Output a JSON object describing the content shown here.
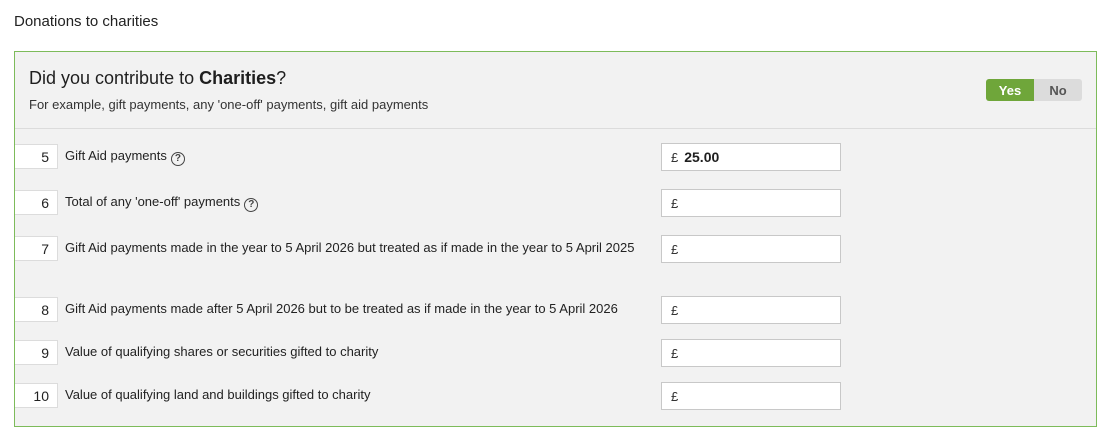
{
  "section_title": "Donations to charities",
  "question": {
    "prefix": "Did you contribute to ",
    "bold": "Charities",
    "suffix": "?",
    "hint": "For example, gift payments, any 'one-off' payments, gift aid payments"
  },
  "toggle": {
    "yes": "Yes",
    "no": "No",
    "selected": "Yes"
  },
  "rows": [
    {
      "num": "5",
      "label": "Gift Aid payments",
      "help": true,
      "currency": "£",
      "value": "25.00"
    },
    {
      "num": "6",
      "label": "Total of any 'one-off' payments",
      "help": true,
      "currency": "£",
      "value": ""
    },
    {
      "num": "7",
      "label": "Gift Aid payments made in the year to 5 April 2026 but treated as if made in the year to 5 April 2025",
      "help": false,
      "currency": "£",
      "value": ""
    },
    {
      "num": "8",
      "label": "Gift Aid payments made after 5 April 2026 but to be treated as if made in the year to 5 April 2026",
      "help": false,
      "currency": "£",
      "value": ""
    },
    {
      "num": "9",
      "label": "Value of qualifying shares or securities gifted to charity",
      "help": false,
      "currency": "£",
      "value": ""
    },
    {
      "num": "10",
      "label": "Value of qualifying land and buildings gifted to charity",
      "help": false,
      "currency": "£",
      "value": ""
    }
  ],
  "colors": {
    "accent": "#6fa63a",
    "border": "#7dbb5a"
  }
}
